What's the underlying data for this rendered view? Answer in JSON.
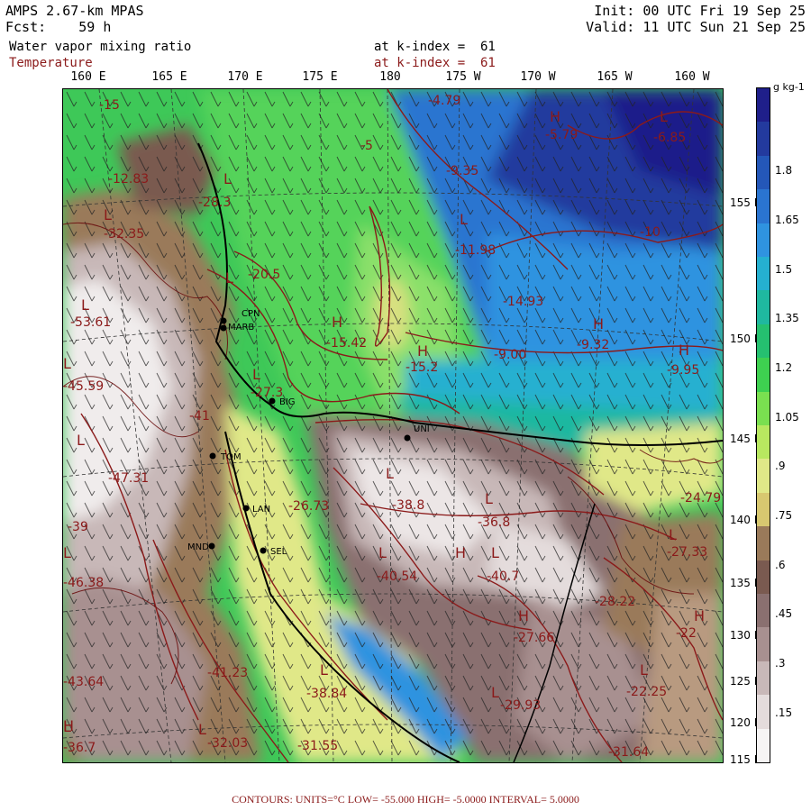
{
  "header": {
    "model": "AMPS 2.67-km MPAS",
    "fcst_label": "Fcst:",
    "fcst_value": "59 h",
    "field1": "Water vapor mixing ratio",
    "field2": "Temperature",
    "level1": "at k-index =  61",
    "level2": "at k-index =  61",
    "init": "Init: 00 UTC Fri 19 Sep 25",
    "valid": "Valid: 11 UTC Sun 21 Sep 25"
  },
  "longitudes": [
    "160 E",
    "165 E",
    "170 E",
    "175 E",
    "180",
    "175 W",
    "170 W",
    "165 W",
    "160 W"
  ],
  "colorbar": {
    "units": "g kg-1",
    "labels": [
      "1.8",
      "1.65",
      "1.5",
      "1.35",
      "1.2",
      "1.05",
      ".9",
      ".75",
      ".6",
      ".45",
      ".3",
      ".15"
    ],
    "colors": [
      "#1f1f8a",
      "#233a9e",
      "#2457b8",
      "#2a74d0",
      "#2f93e0",
      "#25b0d0",
      "#1fb8a0",
      "#25c070",
      "#3ed050",
      "#7ae050",
      "#b8e860",
      "#e0e888",
      "#d8c870",
      "#9a7a5a",
      "#7a5a50",
      "#8a7070",
      "#a89090",
      "#c8b8b8",
      "#e4dcdc",
      "#f6f4f4"
    ]
  },
  "latitudes": [
    "155 N",
    "150 N",
    "145 N",
    "140 N",
    "135 N",
    "130 N",
    "125 N",
    "120 N",
    "115 N"
  ],
  "map": {
    "contour_labels": [
      "-15",
      "-12.83",
      "-28.3",
      "-32.35",
      "-20.5",
      "-53.61",
      "-15.42",
      "-15.2",
      "-27.3",
      "-45.59",
      "-41",
      "-47.31",
      "-39",
      "-46.38",
      "-43.64",
      "-41.23",
      "-38.84",
      "-32.03",
      "-31.55",
      "-36.7",
      "-38.8",
      "-26.73",
      "-40.54",
      "-40.7",
      "-36.8",
      "-27.66",
      "-29.93",
      "-31.64",
      "-22.25",
      "-22",
      "-27.33",
      "-24.79",
      "-28.22",
      "-14.93",
      "-9.00",
      "-9.32",
      "-9.95",
      "-10",
      "-11.98",
      "-9.35",
      "-5.79",
      "-6.85",
      "-4.79",
      "-5"
    ],
    "highs_lows": [
      "L",
      "L",
      "L",
      "L",
      "H",
      "H",
      "L",
      "L",
      "L",
      "L",
      "H",
      "L",
      "L",
      "L",
      "H",
      "L",
      "L",
      "H",
      "H",
      "L",
      "L",
      "L",
      "H",
      "L",
      "L",
      "H",
      "L",
      "L",
      "H"
    ],
    "stations": [
      "CPN",
      "MARB",
      "BIG",
      "TOM",
      "LAN",
      "SEL",
      "MND",
      "UNI"
    ]
  },
  "footer": {
    "text": "CONTOURS:  UNITS=°C  LOW= -55.000      HIGH= -5.0000      INTERVAL=   5.0000"
  }
}
